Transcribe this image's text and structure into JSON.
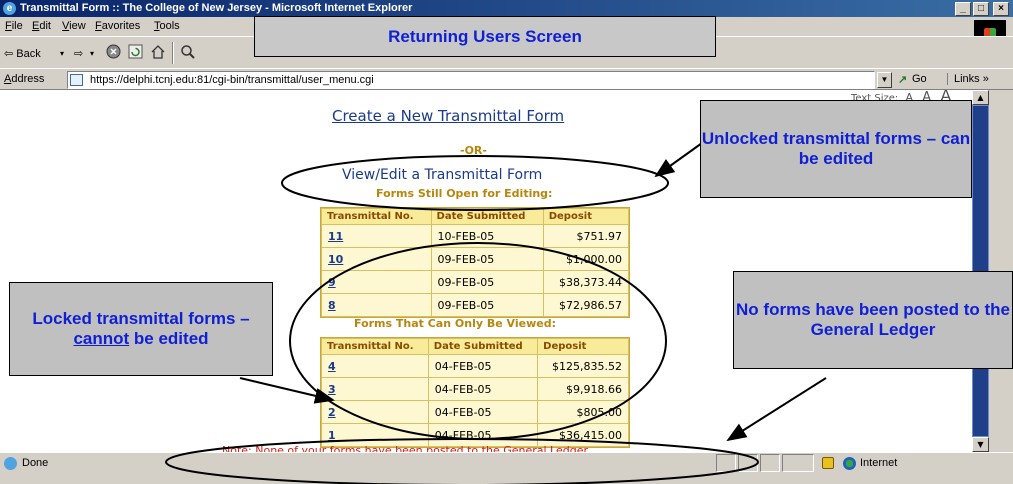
{
  "window": {
    "title": "Transmittal Form :: The College of New Jersey - Microsoft Internet Explorer",
    "controls": {
      "minimize": "_",
      "maximize": "□",
      "close": "×"
    }
  },
  "menubar": {
    "items": [
      "File",
      "Edit",
      "View",
      "Favorites",
      "Tools"
    ]
  },
  "toolbar": {
    "back": "⇦ Back",
    "back_arrow": "▾",
    "forward": "⇨",
    "forward_arrow": "▾"
  },
  "addressbar": {
    "label": "Address",
    "url": "https://delphi.tcnj.edu:81/cgi-bin/transmittal/user_menu.cgi",
    "go": "Go",
    "links": "Links »"
  },
  "page": {
    "text_size_label": "Text Size:",
    "text_size_options": [
      "A",
      "A",
      "A"
    ],
    "create_link": "Create a New Transmittal Form",
    "or_label": "-OR-",
    "view_edit_heading": "View/Edit a Transmittal Form",
    "open_title": "Forms Still Open for Editing:",
    "view_only_title": "Forms That Can Only Be Viewed:",
    "columns": [
      "Transmittal No.",
      "Date Submitted",
      "Deposit"
    ],
    "open_forms": [
      {
        "no": "11",
        "date": "10-FEB-05",
        "deposit": "$751.97"
      },
      {
        "no": "10",
        "date": "09-FEB-05",
        "deposit": "$1,000.00"
      },
      {
        "no": "9",
        "date": "09-FEB-05",
        "deposit": "$38,373.44"
      },
      {
        "no": "8",
        "date": "09-FEB-05",
        "deposit": "$72,986.57"
      }
    ],
    "view_only_forms": [
      {
        "no": "4",
        "date": "04-FEB-05",
        "deposit": "$125,835.52"
      },
      {
        "no": "3",
        "date": "04-FEB-05",
        "deposit": "$9,918.66"
      },
      {
        "no": "2",
        "date": "04-FEB-05",
        "deposit": "$805.00"
      },
      {
        "no": "1",
        "date": "04-FEB-05",
        "deposit": "$36,415.00"
      }
    ],
    "note": "Note: None of your forms have been posted to the General Ledger."
  },
  "statusbar": {
    "text": "Done",
    "zone": "Internet"
  },
  "annotations": {
    "banner": "Returning Users Screen",
    "unlocked": "Unlocked transmittal forms – can be edited",
    "locked_prefix": "Locked transmittal forms – ",
    "locked_emphasis": "cannot",
    "locked_suffix": " be edited",
    "none_posted": "No forms have been posted to the General Ledger"
  },
  "colors": {
    "link_blue": "#1a3a8c",
    "gold": "#b8860b",
    "note_red": "#d91b1b",
    "callout_text": "#0f1fd6"
  }
}
